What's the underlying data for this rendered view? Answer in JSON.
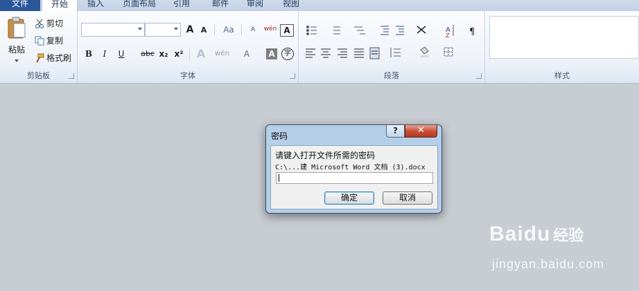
{
  "tabs": [
    "文件",
    "开始",
    "插入",
    "页面布局",
    "引用",
    "邮件",
    "审阅",
    "视图"
  ],
  "clipboard": {
    "paste": "粘贴",
    "cut": "剪切",
    "copy": "复制",
    "format_painter": "格式刷",
    "group_label": "剪贴板"
  },
  "font": {
    "group_label": "字体",
    "font_name": "",
    "font_size": "",
    "bold": "B",
    "italic": "I",
    "underline": "U",
    "strike": "abc",
    "sub": "x₂",
    "sup": "x²",
    "grow": "A",
    "shrink": "A",
    "case": "Aa",
    "clear": "A",
    "phonetic": "wén",
    "border_char": "A",
    "font_color": "A",
    "shade_char": "A",
    "enclose": "字"
  },
  "paragraph": {
    "group_label": "段落"
  },
  "styles": {
    "group_label": "样式"
  },
  "dialog": {
    "title": "密码",
    "help": "?",
    "close": "✕",
    "prompt": "请键入打开文件所需的密码",
    "path": "C:\\...建 Microsoft Word 文档 (3).docx",
    "password_value": "",
    "ok": "确定",
    "cancel": "取消"
  },
  "watermark": {
    "brand": "Bai",
    "brand_mid": "du",
    "brand_cn": "经验",
    "url": "jingyan.baidu.com"
  }
}
